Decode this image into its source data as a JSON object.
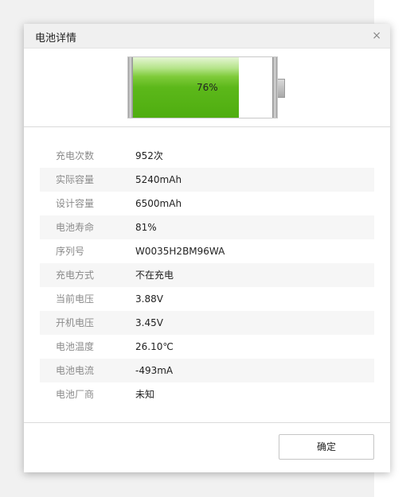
{
  "dialog": {
    "title": "电池详情",
    "close_glyph": "×",
    "ok_label": "确定"
  },
  "battery": {
    "percent_text": "76%",
    "level": 0.76,
    "fill_color": "#5cb81a"
  },
  "details": [
    {
      "label": "充电次数",
      "value": "952次"
    },
    {
      "label": "实际容量",
      "value": "5240mAh"
    },
    {
      "label": "设计容量",
      "value": "6500mAh"
    },
    {
      "label": "电池寿命",
      "value": "81%"
    },
    {
      "label": "序列号",
      "value": "W0035H2BM96WA"
    },
    {
      "label": "充电方式",
      "value": "不在充电"
    },
    {
      "label": "当前电压",
      "value": "3.88V"
    },
    {
      "label": "开机电压",
      "value": "3.45V"
    },
    {
      "label": "电池温度",
      "value": "26.10℃"
    },
    {
      "label": "电池电流",
      "value": "-493mA"
    },
    {
      "label": "电池厂商",
      "value": "未知"
    }
  ]
}
